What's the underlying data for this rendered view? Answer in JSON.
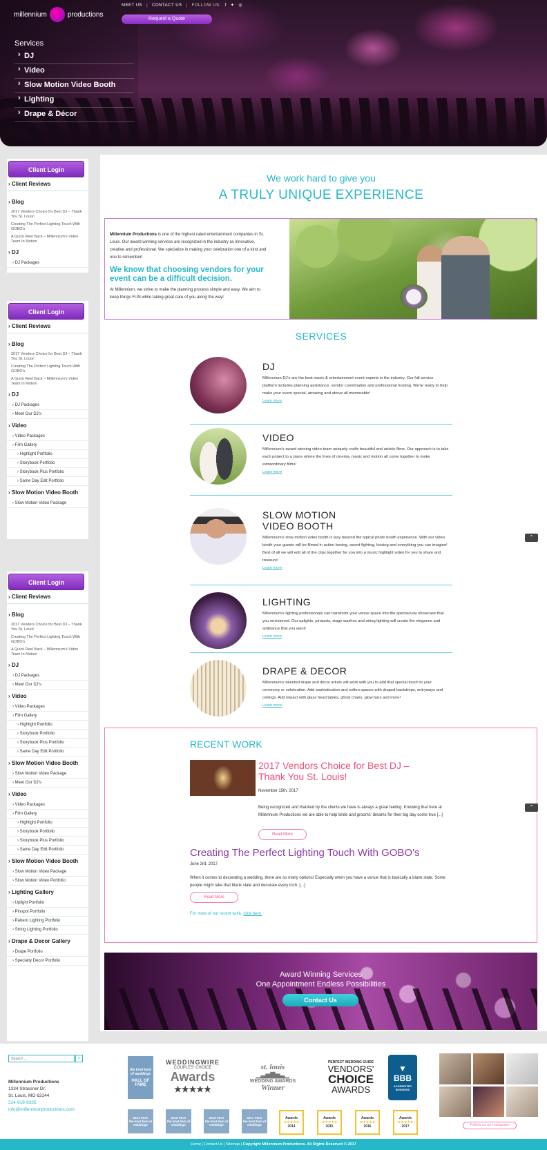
{
  "header": {
    "logo_left": "millennium",
    "logo_right": "productions",
    "nav": [
      "MEET US",
      "CONTACT US",
      "FOLLOW US:"
    ],
    "social_icons": [
      "facebook-icon",
      "twitter-icon",
      "instagram-icon"
    ],
    "quote_button": "Request a Quote",
    "services_label": "Services",
    "services": [
      "DJ",
      "Video",
      "Slow Motion Video Booth",
      "Lighting",
      "Drape & Décor"
    ]
  },
  "sidebar": {
    "login": "Client Login",
    "reviews": "Client Reviews",
    "blog": "Blog",
    "posts": [
      "2017 Vendors Choice for Best DJ – Thank You St. Louis!",
      "Creating The Perfect Lighting Touch With GOBO's",
      "A Quick Reel Back – Millennium's Video Team In Motion"
    ],
    "dj": "DJ",
    "dj_packages": "DJ Packages",
    "meet_djs": "Meet Our DJ's",
    "video": "Video",
    "video_packages": "Video Packages",
    "film_gallery": "Film Gallery",
    "highlight": "Highlight Portfolio",
    "storybook": "Storybook Portfolio",
    "storybook_plus": "Storybook Plus Portfolio",
    "same_day": "Same Day Edit Portfolio",
    "slowmo": "Slow Motion Video Booth",
    "slowmo_package": "Slow Motion Video Package",
    "slowmo_portfolio": "Slow Motion Video Portfolio",
    "lighting_gallery": "Lighting Gallery",
    "uplight": "Uplight Portfolio",
    "pinspot": "Pinspot Portfolio",
    "pattern": "Pattern Lighting Portfolio",
    "string": "String Lighting Portfolio",
    "drape_gallery": "Drape & Decor Gallery",
    "drape_portfolio": "Drape Portfolio",
    "specialty": "Specialty Decor Portfolio"
  },
  "main": {
    "tagline_small": "We work hard to give you",
    "tagline_large": "A TRULY UNIQUE EXPERIENCE",
    "intro_brand": "Millennium Productions",
    "intro_text": " is one of the highest rated entertainment companies in St. Louis. Our award winning services are recognized in the industry as innovative, creative and professional. We specialize in making your celebration one of a kind and one to remember!",
    "intro_heading": "We know that choosing vendors for your event can be a difficult decision.",
    "intro_text2": "At Millennium, we strive to make the planning process simple and easy. We aim to keep things FUN while taking great care of you along the way!",
    "services_title": "SERVICES",
    "learn_more": "Learn more",
    "services": [
      {
        "title": "DJ",
        "text": "Millennium DJ's are the best music & entertainment event experts in the industry. Our full service platform includes planning assistance, vendor coordination and professional hosting. We're ready to help make your event special, amazing and above all memorable!"
      },
      {
        "title": "VIDEO",
        "text": "Millennium's award winning video team uniquely crafts beautiful and artistic films. Our approach is to take each project to a place where the lines of cinema, music and motion all come together to make extraordinary films!"
      },
      {
        "title": "SLOW MOTION VIDEO BOOTH",
        "text": "Millennium's slow motion video booth is way beyond the typical photo booth experience. With our video booth your guests will be filmed in action boxing, sword fighting, kissing and everything you can imagine! Best of all we will edit all of the clips together for you into a music highlight video for you to share and treasure!"
      },
      {
        "title": "LIGHTING",
        "text": "Millennium's lighting professionals can transform your venue space into the spectacular showcase that you envisioned. Our uplights, pinspots, stage washes and string lighting will create the elegance and ambiance that you want!"
      },
      {
        "title": "DRAPE & DECOR",
        "text": "Millennium's talented drape and décor artists will work with you to add that special touch to your ceremony or celebration. Add sophistication and soften spaces with draped backdrops, entryways and ceilings. Add impact with glass head tables, ghost chairs, glow bars and more!"
      }
    ],
    "recent_title": "RECENT WORK",
    "post1": {
      "title": "2017 Vendors Choice for Best DJ – Thank You St. Louis!",
      "date": "November 15th, 2017",
      "text": "Being recognized and thanked by the clients we have is always a great feeling. Knowing that here at Millennium Productions we are able to help bride and grooms' dreams for their big day come true [...]"
    },
    "post2": {
      "title": "Creating The Perfect Lighting Touch With GOBO's",
      "date": "June 3rd, 2017",
      "text": "When it comes to decorating a wedding, there are so many options! Especially when you have a venue that is basically a blank slate. Some people might take that blank slate and decorate every inch. [...]"
    },
    "read_more": "Read More",
    "more_text": "For more of our recent work, ",
    "more_link": "click here.",
    "award_line1": "Award Winning Services",
    "award_line2": "One Appointment Endless Possibilities",
    "contact_button": "Contact Us"
  },
  "footer": {
    "search_placeholder": "Search ...",
    "company": "Millennium Productions",
    "street": "1334 Strassner Dr.",
    "city": "St. Louis, MO 63144",
    "phone": "314-918-9335",
    "email": "info@millenniumproductions.com",
    "badges": {
      "hof_top": "the knot best of weddings",
      "hof": "HALL OF FAME",
      "ww_brand": "WEDDINGWIRE",
      "ww_sub": "COUPLES' CHOICE",
      "ww_awards": "Awards",
      "stl_top": "st. louis",
      "stl_mid": "WEDDING AWARDS",
      "stl_bot": "Winner",
      "pwg_top": "PERFECT WEDDING GUIDE",
      "pwg_v": "VENDORS'",
      "pwg_c": "CHOICE",
      "pwg_a": "AWARDS",
      "bbb": "BBB",
      "bbb_sub": "ACCREDITED BUSINESS",
      "knot_years": [
        "2014 PICK",
        "2015 PICK",
        "2016 PICK",
        "2017 PICK"
      ],
      "knot_label": "the knot best of weddings",
      "ww_years": [
        "2014",
        "2015",
        "2016",
        "2017"
      ],
      "ww_small": "Awards"
    },
    "instagram_button": "Follow us on Instagram",
    "bottom_links": "Home | Contact Us | Sitemap | ",
    "copyright": "Copyright Millennium Productions. All Rights Reserved © 2017"
  }
}
